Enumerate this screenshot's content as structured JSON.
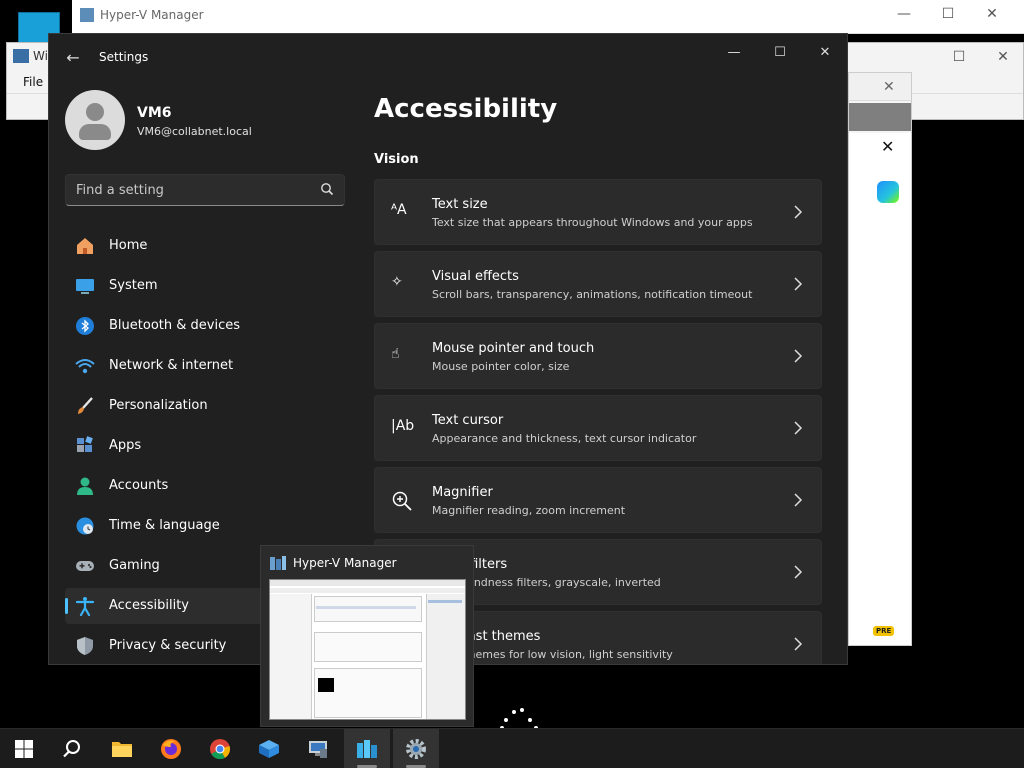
{
  "background": {
    "hyperv_title": "Hyper-V Manager",
    "window2_title": "Wi",
    "window2_menu": "File"
  },
  "settings": {
    "app_title": "Settings",
    "user": {
      "name": "VM6",
      "email": "VM6@collabnet.local"
    },
    "search": {
      "placeholder": "Find a setting"
    },
    "nav": [
      {
        "label": "Home",
        "icon": "home-icon"
      },
      {
        "label": "System",
        "icon": "system-icon"
      },
      {
        "label": "Bluetooth & devices",
        "icon": "bluetooth-icon"
      },
      {
        "label": "Network & internet",
        "icon": "network-icon"
      },
      {
        "label": "Personalization",
        "icon": "personalization-brush-icon"
      },
      {
        "label": "Apps",
        "icon": "apps-icon"
      },
      {
        "label": "Accounts",
        "icon": "accounts-icon"
      },
      {
        "label": "Time & language",
        "icon": "time-language-icon"
      },
      {
        "label": "Gaming",
        "icon": "gaming-icon"
      },
      {
        "label": "Accessibility",
        "icon": "accessibility-icon",
        "selected": true
      },
      {
        "label": "Privacy & security",
        "icon": "privacy-shield-icon"
      }
    ],
    "page_title": "Accessibility",
    "section": "Vision",
    "cards": [
      {
        "title": "Text size",
        "subtitle": "Text size that appears throughout Windows and your apps",
        "icon": "text-size-icon"
      },
      {
        "title": "Visual effects",
        "subtitle": "Scroll bars, transparency, animations, notification timeout",
        "icon": "visual-effects-icon"
      },
      {
        "title": "Mouse pointer and touch",
        "subtitle": "Mouse pointer color, size",
        "icon": "mouse-pointer-icon"
      },
      {
        "title": "Text cursor",
        "subtitle": "Appearance and thickness, text cursor indicator",
        "icon": "text-cursor-icon"
      },
      {
        "title": "Magnifier",
        "subtitle": "Magnifier reading, zoom increment",
        "icon": "magnifier-icon"
      },
      {
        "title": "Color filters",
        "subtitle": "Colorblindness filters, grayscale, inverted",
        "icon": "color-filters-icon"
      },
      {
        "title": "Contrast themes",
        "subtitle": "Color themes for low vision, light sensitivity",
        "icon": "contrast-themes-icon"
      }
    ]
  },
  "preview": {
    "title": "Hyper-V Manager"
  },
  "edge": {
    "badge": "PRE"
  },
  "taskbar": [
    {
      "name": "start-button",
      "icon": "windows-start-icon"
    },
    {
      "name": "search-button",
      "icon": "search-icon"
    },
    {
      "name": "file-explorer-button",
      "icon": "folder-icon"
    },
    {
      "name": "firefox-button",
      "icon": "firefox-icon"
    },
    {
      "name": "chrome-button",
      "icon": "chrome-icon"
    },
    {
      "name": "azure-button",
      "icon": "azure-cube-icon"
    },
    {
      "name": "server-manager-button",
      "icon": "server-manager-icon"
    },
    {
      "name": "hyperv-manager-button",
      "icon": "hyperv-icon"
    },
    {
      "name": "settings-button",
      "icon": "gear-icon"
    }
  ],
  "colors": {
    "accent": "#4cc2ff",
    "window_bg": "#202020",
    "card_bg": "#2b2b2b"
  }
}
